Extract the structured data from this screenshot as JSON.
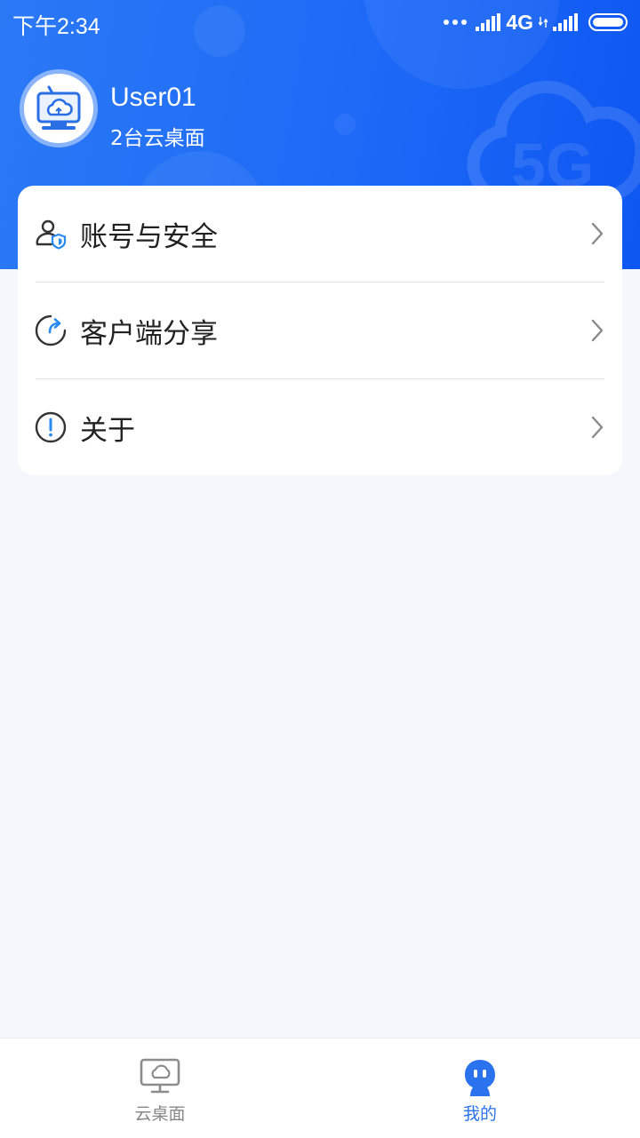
{
  "status_bar": {
    "time": "下午2:34",
    "network": "4G"
  },
  "profile": {
    "username": "User01",
    "desktop_count": "2台云桌面"
  },
  "menu": {
    "items": [
      {
        "label": "账号与安全",
        "icon": "user-shield-icon"
      },
      {
        "label": "客户端分享",
        "icon": "share-icon"
      },
      {
        "label": "关于",
        "icon": "info-icon"
      }
    ]
  },
  "bottom_nav": {
    "tabs": [
      {
        "label": "云桌面",
        "icon": "cloud-desktop-icon",
        "active": false
      },
      {
        "label": "我的",
        "icon": "robot-mine-icon",
        "active": true
      }
    ]
  },
  "colors": {
    "primary": "#1d6af7",
    "text": "#222222",
    "muted": "#888888",
    "background": "#f4f7fb"
  }
}
